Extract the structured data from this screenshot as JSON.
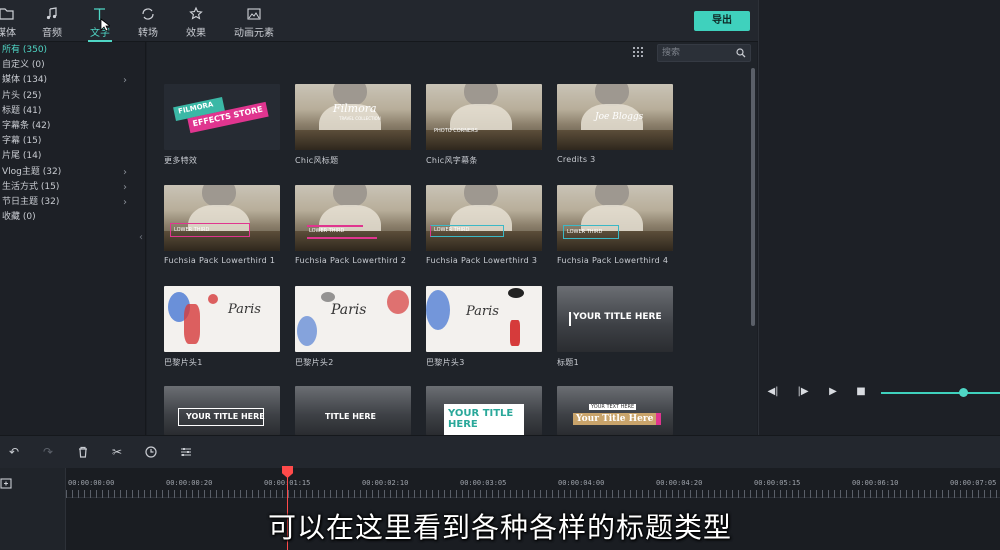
{
  "toolbar": {
    "tabs": [
      {
        "label": "媒体",
        "icon": "folder-icon"
      },
      {
        "label": "音频",
        "icon": "music-note-icon"
      },
      {
        "label": "文字",
        "icon": "text-icon"
      },
      {
        "label": "转场",
        "icon": "transition-icon"
      },
      {
        "label": "效果",
        "icon": "effects-icon"
      },
      {
        "label": "动画元素",
        "icon": "image-icon"
      }
    ],
    "active_tab": "文字",
    "export_label": "导出"
  },
  "sidebar": {
    "categories": [
      {
        "label": "所有 (350)",
        "selected": true,
        "expandable": false
      },
      {
        "label": "自定义 (0)",
        "expandable": false
      },
      {
        "label": "媒体 (134)",
        "expandable": true
      },
      {
        "label": "片头 (25)",
        "expandable": false
      },
      {
        "label": "标题 (41)",
        "expandable": false
      },
      {
        "label": "字幕条 (42)",
        "expandable": false
      },
      {
        "label": "字幕 (15)",
        "expandable": false
      },
      {
        "label": "片尾 (14)",
        "expandable": false
      },
      {
        "label": "Vlog主题 (32)",
        "expandable": true
      },
      {
        "label": "生活方式 (15)",
        "expandable": true
      },
      {
        "label": "节日主题 (32)",
        "expandable": true
      },
      {
        "label": "收藏 (0)",
        "expandable": false
      }
    ]
  },
  "search": {
    "placeholder": "搜索",
    "value": ""
  },
  "grid": {
    "items": [
      {
        "label": "更多特效",
        "thumb_text": [
          "FILMORA",
          "EFFECTS STORE"
        ]
      },
      {
        "label": "Chic风标题",
        "thumb_text": [
          "Filmora",
          "TRAVEL COLLECTION"
        ]
      },
      {
        "label": "Chic风字幕条",
        "thumb_text": [
          "PHOTO CORNERS"
        ]
      },
      {
        "label": "Credits 3",
        "thumb_text": [
          "Joe Bloggs"
        ]
      },
      {
        "label": "Fuchsia Pack Lowerthird 1",
        "thumb_text": [
          "LOWER THIRD"
        ]
      },
      {
        "label": "Fuchsia Pack Lowerthird 2",
        "thumb_text": [
          "LOWER THIRD"
        ]
      },
      {
        "label": "Fuchsia Pack Lowerthird 3",
        "thumb_text": [
          "LOWER THIRD"
        ]
      },
      {
        "label": "Fuchsia Pack Lowerthird 4",
        "thumb_text": [
          "LOWER THIRD"
        ]
      },
      {
        "label": "巴黎片头1",
        "thumb_text": [
          "Paris"
        ]
      },
      {
        "label": "巴黎片头2",
        "thumb_text": [
          "Paris"
        ]
      },
      {
        "label": "巴黎片头3",
        "thumb_text": [
          "Paris"
        ]
      },
      {
        "label": "标题1",
        "thumb_text": [
          "YOUR TITLE HERE"
        ]
      },
      {
        "label": "",
        "thumb_text": [
          "YOUR TITLE HERE"
        ]
      },
      {
        "label": "",
        "thumb_text": [
          "TITLE HERE"
        ]
      },
      {
        "label": "",
        "thumb_text": [
          "YOUR TITLE HERE"
        ]
      },
      {
        "label": "",
        "thumb_text": [
          "YOUR TEXT HERE",
          "Your Title Here"
        ]
      }
    ]
  },
  "timeline": {
    "ticks": [
      "00:00:00:00",
      "00:00:00:20",
      "00:00:01:15",
      "00:00:02:10",
      "00:00:03:05",
      "00:00:04:00",
      "00:00:04:20",
      "00:00:05:15",
      "00:00:06:10",
      "00:00:07:05"
    ]
  },
  "subtitle": "可以在这里看到各种各样的标题类型",
  "colors": {
    "accent": "#4fd6c5",
    "export_button": "#3fd1bd",
    "playhead": "#ff4a4a",
    "fuchsia": "#e0358f"
  }
}
